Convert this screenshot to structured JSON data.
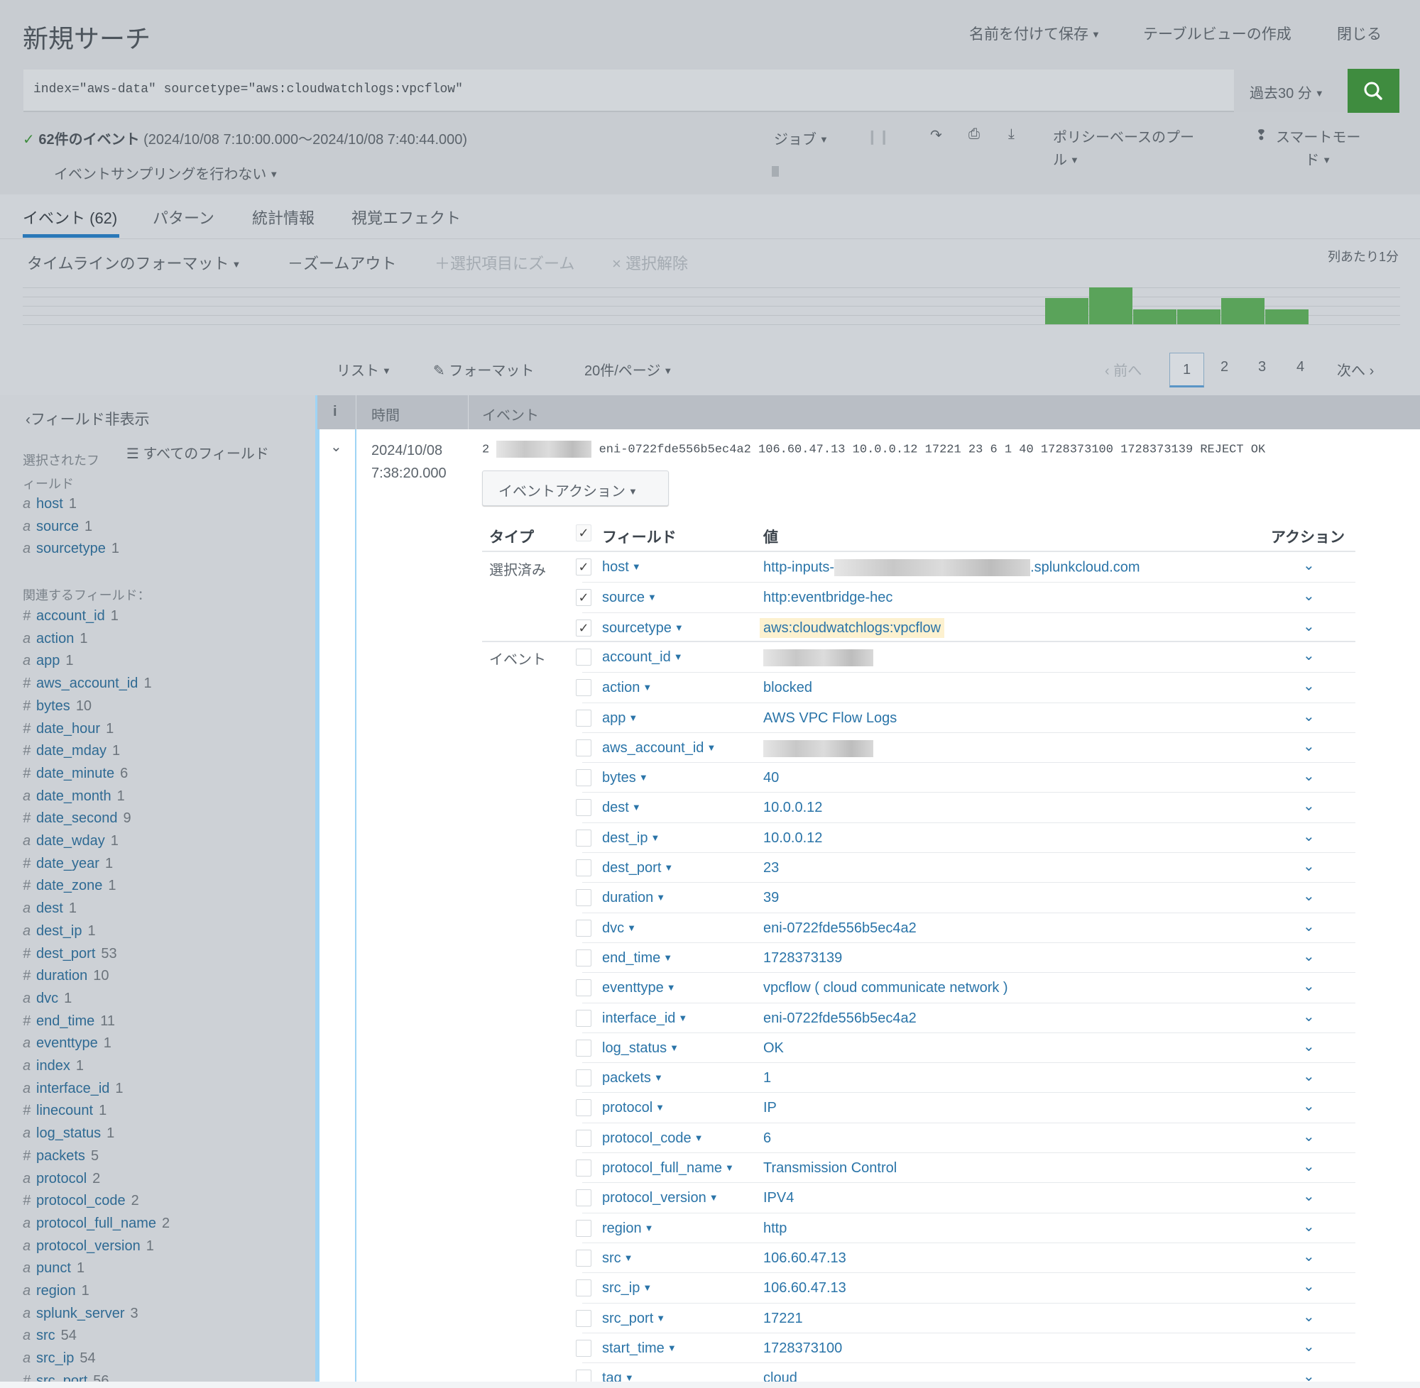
{
  "header": {
    "title": "新規サーチ",
    "save_as": "名前を付けて保存",
    "create_table_view": "テーブルビューの作成",
    "close": "閉じる"
  },
  "search": {
    "query": "index=\"aws-data\" sourcetype=\"aws:cloudwatchlogs:vpcflow\"",
    "time_range": "過去30 分",
    "search_icon": "search-icon",
    "button_color": "#3f8c3f"
  },
  "status": {
    "count_label": "62件のイベント",
    "range": "(2024/10/08 7:10:00.000～2024/10/08 7:40:44.000)",
    "sampling": "イベントサンプリングを行わない",
    "job": "ジョブ",
    "policy_line1": "ポリシーベースのプー",
    "policy_line2": "ル",
    "mode_line1": "スマートモー",
    "mode_line2": "ド"
  },
  "tabs": [
    {
      "label": "イベント (62)",
      "active": true
    },
    {
      "label": "パターン"
    },
    {
      "label": "統計情報"
    },
    {
      "label": "視覚エフェクト"
    }
  ],
  "timeline": {
    "format": "タイムラインのフォーマット",
    "zoom_out": "－ズームアウト",
    "zoom_selection": "＋選択項目にズーム",
    "deselect": "× 選択解除",
    "scale": "列あたり1分",
    "bar_color": "#5aa35a",
    "counts": [
      12,
      17,
      7,
      7,
      12,
      7
    ]
  },
  "results_toolbar": {
    "list": "リスト",
    "format": "フォーマット",
    "per_page": "20件/ページ",
    "prev": "前へ",
    "next": "次へ",
    "pages": [
      "1",
      "2",
      "3",
      "4"
    ],
    "current_page": "1"
  },
  "sidebar": {
    "hide_fields": "フィールド非表示",
    "selected_title_1": "選択されたフ",
    "selected_title_2": "ィールド",
    "all_fields": "すべてのフィールド",
    "interesting_title": "関連するフィールド：",
    "selected": [
      {
        "type": "a",
        "name": "host",
        "count": "1"
      },
      {
        "type": "a",
        "name": "source",
        "count": "1"
      },
      {
        "type": "a",
        "name": "sourcetype",
        "count": "1"
      }
    ],
    "interesting": [
      {
        "type": "#",
        "name": "account_id",
        "count": "1"
      },
      {
        "type": "a",
        "name": "action",
        "count": "1"
      },
      {
        "type": "a",
        "name": "app",
        "count": "1"
      },
      {
        "type": "#",
        "name": "aws_account_id",
        "count": "1"
      },
      {
        "type": "#",
        "name": "bytes",
        "count": "10"
      },
      {
        "type": "#",
        "name": "date_hour",
        "count": "1"
      },
      {
        "type": "#",
        "name": "date_mday",
        "count": "1"
      },
      {
        "type": "#",
        "name": "date_minute",
        "count": "6"
      },
      {
        "type": "a",
        "name": "date_month",
        "count": "1"
      },
      {
        "type": "#",
        "name": "date_second",
        "count": "9"
      },
      {
        "type": "a",
        "name": "date_wday",
        "count": "1"
      },
      {
        "type": "#",
        "name": "date_year",
        "count": "1"
      },
      {
        "type": "#",
        "name": "date_zone",
        "count": "1"
      },
      {
        "type": "a",
        "name": "dest",
        "count": "1"
      },
      {
        "type": "a",
        "name": "dest_ip",
        "count": "1"
      },
      {
        "type": "#",
        "name": "dest_port",
        "count": "53"
      },
      {
        "type": "#",
        "name": "duration",
        "count": "10"
      },
      {
        "type": "a",
        "name": "dvc",
        "count": "1"
      },
      {
        "type": "#",
        "name": "end_time",
        "count": "11"
      },
      {
        "type": "a",
        "name": "eventtype",
        "count": "1"
      },
      {
        "type": "a",
        "name": "index",
        "count": "1"
      },
      {
        "type": "a",
        "name": "interface_id",
        "count": "1"
      },
      {
        "type": "#",
        "name": "linecount",
        "count": "1"
      },
      {
        "type": "a",
        "name": "log_status",
        "count": "1"
      },
      {
        "type": "#",
        "name": "packets",
        "count": "5"
      },
      {
        "type": "a",
        "name": "protocol",
        "count": "2"
      },
      {
        "type": "#",
        "name": "protocol_code",
        "count": "2"
      },
      {
        "type": "a",
        "name": "protocol_full_name",
        "count": "2"
      },
      {
        "type": "a",
        "name": "protocol_version",
        "count": "1"
      },
      {
        "type": "a",
        "name": "punct",
        "count": "1"
      },
      {
        "type": "a",
        "name": "region",
        "count": "1"
      },
      {
        "type": "a",
        "name": "splunk_server",
        "count": "3"
      },
      {
        "type": "a",
        "name": "src",
        "count": "54"
      },
      {
        "type": "a",
        "name": "src_ip",
        "count": "54"
      },
      {
        "type": "#",
        "name": "src_port",
        "count": "56"
      }
    ]
  },
  "table": {
    "col_info": "i",
    "col_time": "時間",
    "col_event": "イベント"
  },
  "event": {
    "date": "2024/10/08",
    "time": "7:38:20.000",
    "raw_prefix": "2",
    "raw_rest": "eni-0722fde556b5ec4a2 106.60.47.13 10.0.0.12 17221 23 6 1 40 1728373100 1728373139 REJECT OK",
    "actions_button": "イベントアクション"
  },
  "fields": {
    "col_type": "タイプ",
    "col_field": "フィールド",
    "col_value": "値",
    "col_action": "アクション",
    "group_selected": "選択済み",
    "group_event": "イベント",
    "highlight_color": "#fdf1cf",
    "rows": [
      {
        "name": "host",
        "value_prefix": "http-inputs-",
        "value": ".splunkcloud.com",
        "checked": true,
        "redact": "mid"
      },
      {
        "name": "source",
        "value": "http:eventbridge-hec",
        "checked": true
      },
      {
        "name": "sourcetype",
        "value": "aws:cloudwatchlogs:vpcflow",
        "checked": true,
        "highlight": true
      },
      {
        "name": "account_id",
        "value": "",
        "redact": "full"
      },
      {
        "name": "action",
        "value": "blocked"
      },
      {
        "name": "app",
        "value": "AWS VPC Flow Logs"
      },
      {
        "name": "aws_account_id",
        "value": "",
        "redact": "full"
      },
      {
        "name": "bytes",
        "value": "40"
      },
      {
        "name": "dest",
        "value": "10.0.0.12"
      },
      {
        "name": "dest_ip",
        "value": "10.0.0.12"
      },
      {
        "name": "dest_port",
        "value": "23"
      },
      {
        "name": "duration",
        "value": "39"
      },
      {
        "name": "dvc",
        "value": "eni-0722fde556b5ec4a2"
      },
      {
        "name": "end_time",
        "value": "1728373139"
      },
      {
        "name": "eventtype",
        "value": "vpcflow ( cloud  communicate  network )"
      },
      {
        "name": "interface_id",
        "value": "eni-0722fde556b5ec4a2"
      },
      {
        "name": "log_status",
        "value": "OK"
      },
      {
        "name": "packets",
        "value": "1"
      },
      {
        "name": "protocol",
        "value": "IP"
      },
      {
        "name": "protocol_code",
        "value": "6"
      },
      {
        "name": "protocol_full_name",
        "value": "Transmission Control"
      },
      {
        "name": "protocol_version",
        "value": "IPV4"
      },
      {
        "name": "region",
        "value": "http"
      },
      {
        "name": "src",
        "value": "106.60.47.13"
      },
      {
        "name": "src_ip",
        "value": "106.60.47.13"
      },
      {
        "name": "src_port",
        "value": "17221"
      },
      {
        "name": "start_time",
        "value": "1728373100"
      },
      {
        "name": "tag",
        "value": "cloud"
      }
    ]
  }
}
